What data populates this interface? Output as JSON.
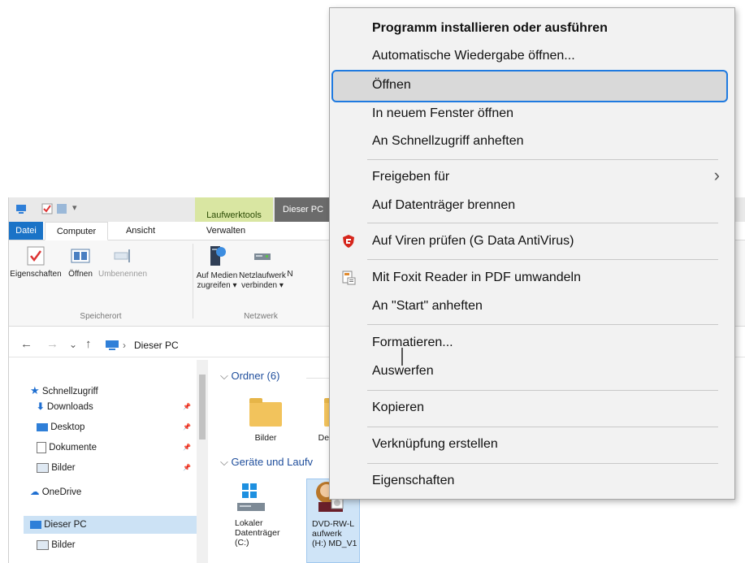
{
  "explorer": {
    "context_tab": "Laufwerktools",
    "title": "Dieser PC",
    "tabs": [
      "Datei",
      "Computer",
      "Ansicht",
      "Verwalten"
    ],
    "ribbon": {
      "properties": "Eigenschaften",
      "open": "Öffnen",
      "rename": "Umbenennen",
      "media_line1": "Auf Medien",
      "media_line2": "zugreifen ▾",
      "netdrive_line1": "Netzlaufwerk",
      "netdrive_line2": "verbinden ▾",
      "n_cut": "N",
      "group_location": "Speicherort",
      "group_network": "Netzwerk"
    },
    "address": {
      "back": "←",
      "forward": "→",
      "recent": "⌄",
      "up": "↑",
      "separator": "›",
      "crumb": "Dieser PC"
    },
    "nav": [
      {
        "label": "Schnellzugriff",
        "icon": "star-icon"
      },
      {
        "label": "Downloads",
        "icon": "download-icon",
        "pinned": true
      },
      {
        "label": "Desktop",
        "icon": "desktop-icon",
        "pinned": true
      },
      {
        "label": "Dokumente",
        "icon": "document-icon",
        "pinned": true
      },
      {
        "label": "Bilder",
        "icon": "pictures-icon",
        "pinned": true
      },
      {
        "label": "OneDrive",
        "icon": "cloud-icon"
      },
      {
        "label": "Dieser PC",
        "icon": "computer-icon",
        "selected": true
      },
      {
        "label": "Bilder",
        "icon": "pictures-icon"
      }
    ],
    "pin_glyph": "📌",
    "groups": {
      "folders": "Ordner (6)",
      "devices": "Geräte und Laufv"
    },
    "folders": [
      "Bilder",
      "Des"
    ],
    "drives": [
      {
        "line1": "Lokaler",
        "line2": "Datenträger",
        "line3": "(C:)"
      },
      {
        "line1": "DVD-RW-L",
        "line2": "aufwerk",
        "line3": "(H:) MD_V1"
      }
    ]
  },
  "menu": {
    "items": [
      {
        "label": "Programm installieren oder ausführen",
        "bold": true
      },
      {
        "label": "Automatische Wiedergabe öffnen..."
      },
      {
        "label": "Öffnen",
        "highlighted": true
      },
      {
        "label": "In neuem Fenster öffnen"
      },
      {
        "label": "An Schnellzugriff anheften"
      },
      {
        "label": "Freigeben für",
        "submenu": true
      },
      {
        "label": "Auf Datenträger brennen"
      },
      {
        "label": "Auf Viren prüfen (G Data AntiVirus)",
        "icon": "gdata-shield-icon"
      },
      {
        "label": "Mit Foxit Reader in PDF umwandeln",
        "icon": "foxit-pdf-icon"
      },
      {
        "label": "An \"Start\" anheften"
      },
      {
        "label": "Formatieren..."
      },
      {
        "label": "Auswerfen"
      },
      {
        "label": "Kopieren"
      },
      {
        "label": "Verknüpfung erstellen"
      },
      {
        "label": "Eigenschaften"
      }
    ],
    "submenu_glyph": "›"
  },
  "colors": {
    "accent": "#1a73c7",
    "highlight_border": "#1f7ae0",
    "context_tab": "#d9e6a2",
    "gdata_red": "#d6261c"
  }
}
